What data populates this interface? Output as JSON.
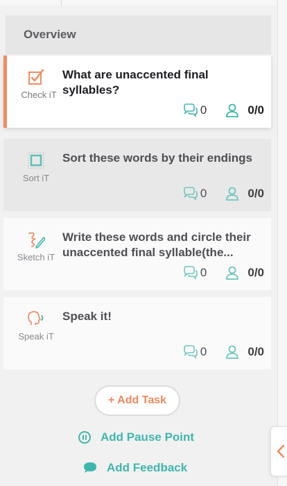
{
  "overview": {
    "label": "Overview"
  },
  "tasks": [
    {
      "type_label": "Check iT",
      "type_icon": "check-it-icon",
      "title": "What are unaccented final syllables?",
      "comments": "0",
      "students": "0/0",
      "state": "active"
    },
    {
      "type_label": "Sort iT",
      "type_icon": "sort-it-icon",
      "title": "Sort these words by their endings",
      "comments": "0",
      "students": "0/0",
      "state": "muted"
    },
    {
      "type_label": "Sketch iT",
      "type_icon": "sketch-it-icon",
      "title": "Write these words and circle their unaccented final syllable(the...",
      "comments": "0",
      "students": "0/0",
      "state": "plain"
    },
    {
      "type_label": "Speak iT",
      "type_icon": "speak-it-icon",
      "title": "Speak it!",
      "comments": "0",
      "students": "0/0",
      "state": "plain"
    }
  ],
  "actions": {
    "add_task": "+ Add Task",
    "add_pause_point": "Add Pause Point",
    "add_feedback": "Add Feedback"
  },
  "icons": {
    "comments": "comments-icon",
    "students": "user-icon",
    "pause": "pause-circle-icon",
    "feedback": "speech-bubble-icon",
    "collapse": "chevron-left-icon"
  },
  "colors": {
    "accent_orange": "#f08c63",
    "accent_teal": "#3fb7ad",
    "active_border": "#f08c63"
  }
}
